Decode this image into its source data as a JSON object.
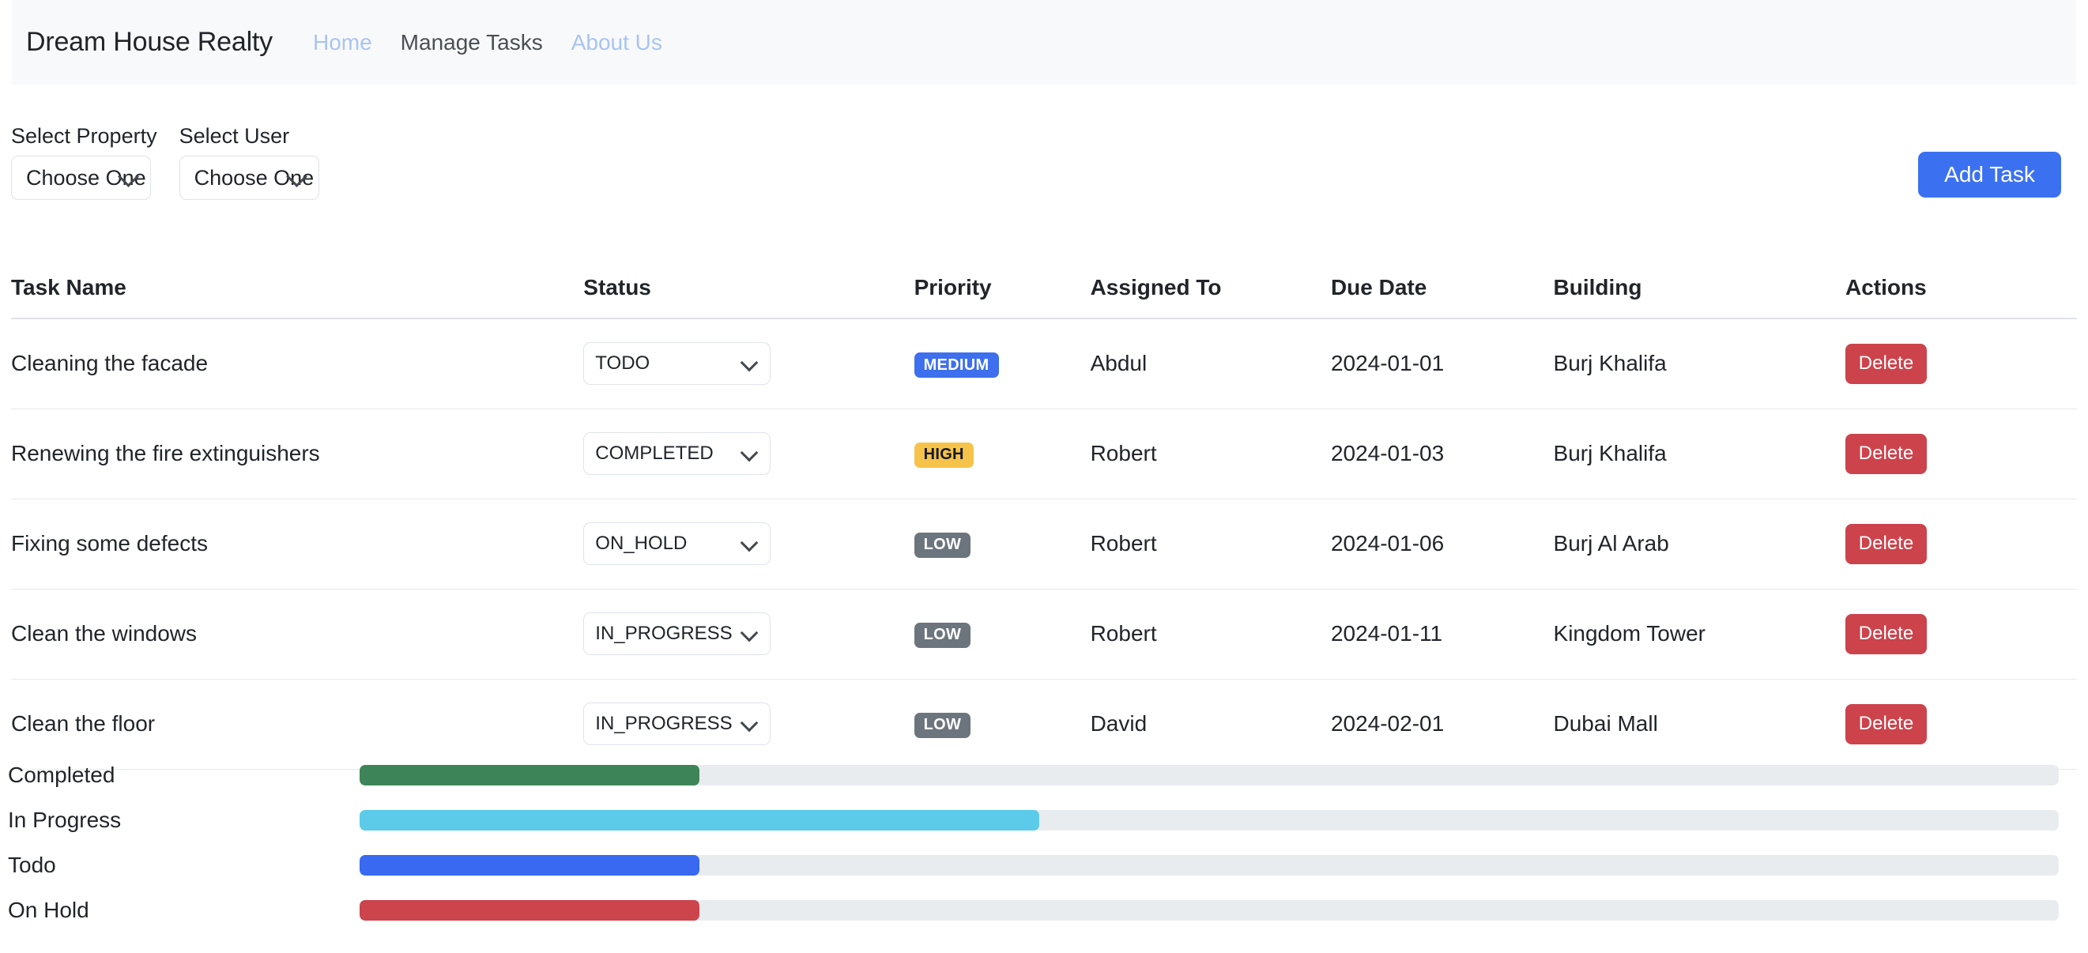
{
  "navbar": {
    "brand": "Dream House Realty",
    "links": [
      {
        "label": "Home",
        "style": "muted"
      },
      {
        "label": "Manage Tasks",
        "style": "dark"
      },
      {
        "label": "About Us",
        "style": "muted"
      }
    ]
  },
  "filters": {
    "property": {
      "label": "Select Property",
      "value": "Choose One"
    },
    "user": {
      "label": "Select User",
      "value": "Choose One"
    },
    "add_task_label": "Add Task"
  },
  "table": {
    "headers": [
      "Task Name",
      "Status",
      "Priority",
      "Assigned To",
      "Due Date",
      "Building",
      "Actions"
    ],
    "delete_label": "Delete",
    "rows": [
      {
        "task": "Cleaning the facade",
        "status": "TODO",
        "priority": "MEDIUM",
        "assigned_to": "Abdul",
        "due_date": "2024-01-01",
        "building": "Burj Khalifa"
      },
      {
        "task": "Renewing the fire extinguishers",
        "status": "COMPLETED",
        "priority": "HIGH",
        "assigned_to": "Robert",
        "due_date": "2024-01-03",
        "building": "Burj Khalifa"
      },
      {
        "task": "Fixing some defects",
        "status": "ON_HOLD",
        "priority": "LOW",
        "assigned_to": "Robert",
        "due_date": "2024-01-06",
        "building": "Burj Al Arab"
      },
      {
        "task": "Clean the windows",
        "status": "IN_PROGRESS",
        "priority": "LOW",
        "assigned_to": "Robert",
        "due_date": "2024-01-11",
        "building": "Kingdom Tower"
      },
      {
        "task": "Clean the floor",
        "status": "IN_PROGRESS",
        "priority": "LOW",
        "assigned_to": "David",
        "due_date": "2024-02-01",
        "building": "Dubai Mall"
      }
    ]
  },
  "chart_data": {
    "type": "bar",
    "orientation": "horizontal",
    "title": "",
    "xlabel": "",
    "ylabel": "",
    "xlim": [
      0,
      100
    ],
    "grid": false,
    "legend": "none",
    "categories": [
      "Completed",
      "In Progress",
      "Todo",
      "On Hold"
    ],
    "values": [
      20,
      40,
      20,
      20
    ],
    "unit": "percent",
    "track_color": "#e9ecef",
    "colors": [
      "#3d8558",
      "#5bcbe9",
      "#3869f0",
      "#cc444c"
    ]
  },
  "colors": {
    "navbar_bg": "#f8f9fa",
    "accent_blue": "#3b71f0",
    "danger_red": "#cc434c",
    "badge_medium": "#3d6fee",
    "badge_high": "#f5c349",
    "badge_low": "#6c757d"
  }
}
